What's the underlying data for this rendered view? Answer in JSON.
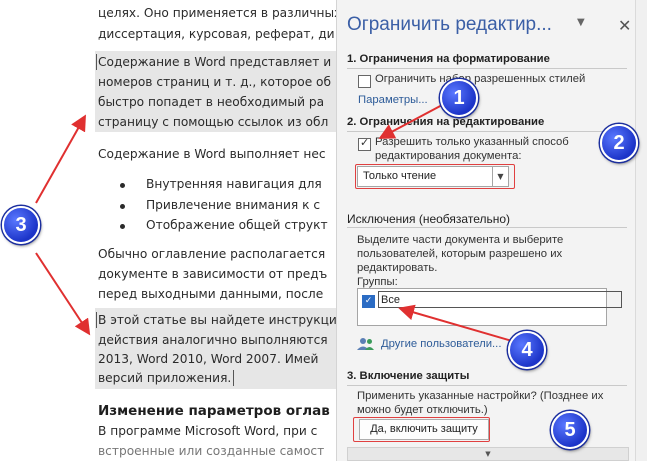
{
  "document": {
    "lines": [
      "целях. Оно применяется в различных",
      "диссертация, курсовая, реферат, ди",
      "Содержание в Word представляет и",
      "номеров страниц и т. д., которое об",
      "быстро попадет в необходимый ра",
      "страницу с помощью ссылок из обл",
      "Содержание в Word выполняет нес",
      "Обычно оглавление располагается",
      "документе в зависимости от предъ",
      "перед выходными данными, после",
      "В этой статье вы найдете инструкци",
      "действия аналогично выполняются",
      "2013, Word 2010, Word 2007. Имей",
      "версий приложения.",
      "В программе Microsoft Word, при с",
      "встроенные или созданные самост"
    ],
    "bullets": [
      "Внутренняя навигация для",
      "Привлечение внимания к с",
      "Отображение общей структ"
    ],
    "heading": "Изменение параметров оглав"
  },
  "pane": {
    "title": "Ограничить редактир...",
    "menu_icon": "dropdown-triangle-icon",
    "close_icon": "close-icon",
    "section1": {
      "title": "1. Ограничения на форматирование",
      "checkbox_label": "Ограничить набор разрешенных стилей",
      "checked": false,
      "link": "Параметры..."
    },
    "section2": {
      "title": "2. Ограничения на редактирование",
      "checkbox_label_1": "Разрешить только указанный способ",
      "checkbox_label_2": "редактирования документа:",
      "checked": true,
      "select_value": "Только чтение",
      "exceptions_title": "Исключения (необязательно)",
      "exceptions_text_1": "Выделите части документа и выберите",
      "exceptions_text_2": "пользователей, которым разрешено их",
      "exceptions_text_3": "редактировать.",
      "groups_label": "Группы:",
      "group_item": "Все",
      "group_checked": true,
      "other_users_link": "Другие пользователи..."
    },
    "section3": {
      "title": "3. Включение защиты",
      "text_1": "Применить указанные настройки? (Позднее их",
      "text_2": "можно будет отключить.)",
      "button": "Да, включить защиту"
    }
  },
  "annotations": {
    "badges": [
      "1",
      "2",
      "3",
      "4",
      "5"
    ],
    "arrow_color": "#e03030",
    "badge_color": "#2a44d8"
  }
}
